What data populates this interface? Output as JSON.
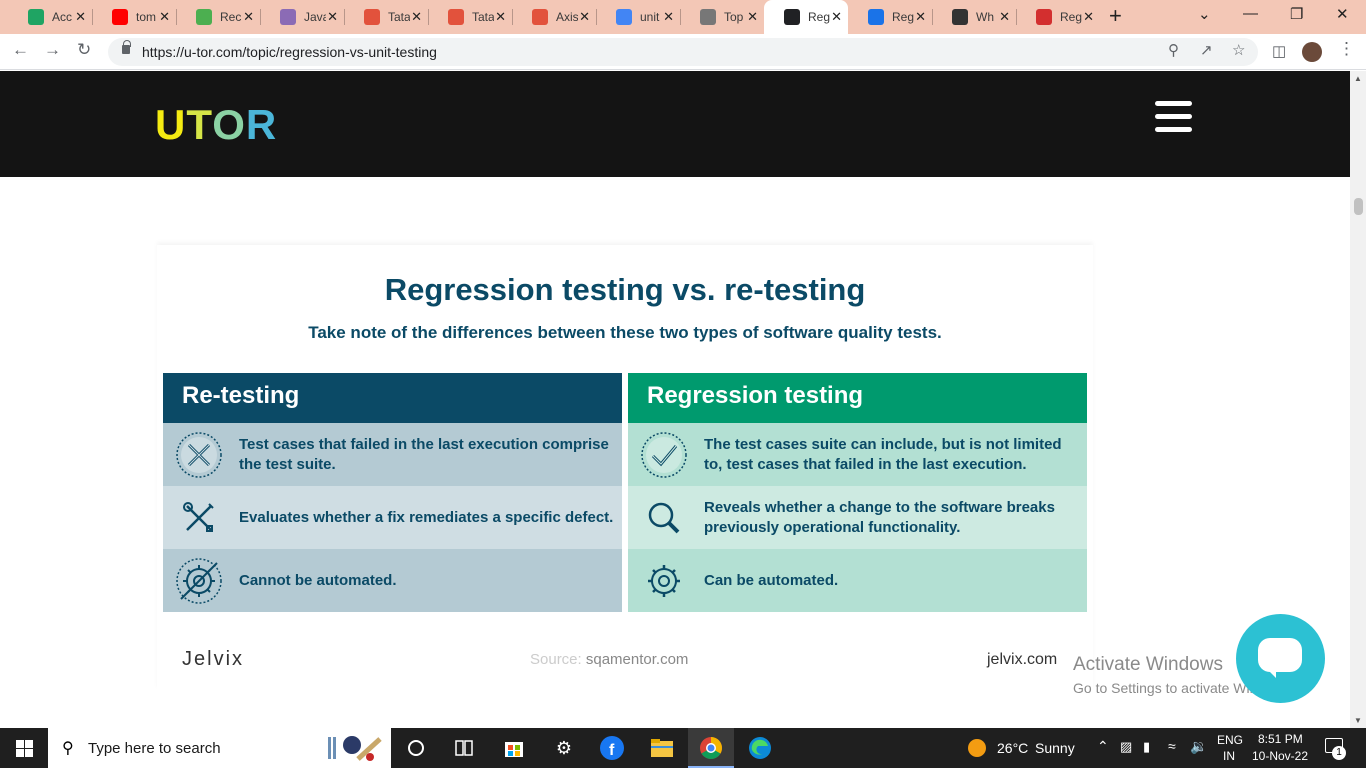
{
  "browser": {
    "tabs": [
      {
        "title": "Acc",
        "favicon": "google-drive-icon",
        "color": "#1fa463"
      },
      {
        "title": "tom",
        "favicon": "youtube-icon",
        "color": "#ff0000"
      },
      {
        "title": "Rec",
        "favicon": "dots-icon",
        "color": "#4caf50"
      },
      {
        "title": "Java",
        "favicon": "avatar-icon",
        "color": "#8b6bb5"
      },
      {
        "title": "Tata",
        "favicon": "tata-icon",
        "color": "#e2523c"
      },
      {
        "title": "Tata",
        "favicon": "tata-icon",
        "color": "#e2523c"
      },
      {
        "title": "Axis",
        "favicon": "axis-icon",
        "color": "#e2523c"
      },
      {
        "title": "unit",
        "favicon": "google-icon",
        "color": "#4285f4"
      },
      {
        "title": "Top",
        "favicon": "cignitti-icon",
        "color": "#777777"
      },
      {
        "title": "Reg",
        "favicon": "utor-icon",
        "color": "#202124"
      },
      {
        "title": "Reg",
        "favicon": "refresh-logo-icon",
        "color": "#1a73e8"
      },
      {
        "title": "Wh",
        "favicon": "dark-logo-icon",
        "color": "#333333"
      },
      {
        "title": "Reg",
        "favicon": "red-logo-icon",
        "color": "#d32f2f"
      }
    ],
    "active_tab_index": 9,
    "url": "https://u-tor.com/topic/regression-vs-unit-testing"
  },
  "site": {
    "logo_letters": [
      "U",
      "T",
      "O",
      "R"
    ]
  },
  "infographic": {
    "title": "Regression testing vs. re-testing",
    "subtitle": "Take note of the differences between these two types of software quality tests.",
    "left_header": "Re-testing",
    "right_header": "Regression testing",
    "left_rows": [
      {
        "icon": "x-circle-icon",
        "text": "Test cases that failed in the last execution comprise the test suite."
      },
      {
        "icon": "tools-icon",
        "text": "Evaluates whether a fix remediates a specific defect."
      },
      {
        "icon": "no-gear-icon",
        "text": "Cannot be automated."
      }
    ],
    "right_rows": [
      {
        "icon": "check-circle-icon",
        "text": "The test cases suite can include, but is not limited to, test cases that failed in the last execution."
      },
      {
        "icon": "magnifier-icon",
        "text": "Reveals whether a change to the software breaks previously operational functionality."
      },
      {
        "icon": "gear-icon",
        "text": "Can be automated."
      }
    ],
    "colors": {
      "left_header_bg": "#0b4a66",
      "right_header_bg": "#009a6e",
      "left_row_dark": "#b4cad3",
      "left_row_light": "#cfdde3",
      "right_row_dark": "#b3e0d3",
      "right_row_light": "#cdeae1"
    },
    "footer_brand": "Jelvix",
    "source_label": "Source:",
    "source_value": "sqamentor.com",
    "footer_site": "jelvix.com"
  },
  "watermark": {
    "line1": "Activate Windows",
    "line2": "Go to Settings to activate Windows."
  },
  "taskbar": {
    "search_placeholder": "Type here to search",
    "weather_temp": "26°C",
    "weather_text": "Sunny",
    "lang_line1": "ENG",
    "lang_line2": "IN",
    "time": "8:51 PM",
    "date": "10-Nov-22",
    "notification_count": "1"
  }
}
